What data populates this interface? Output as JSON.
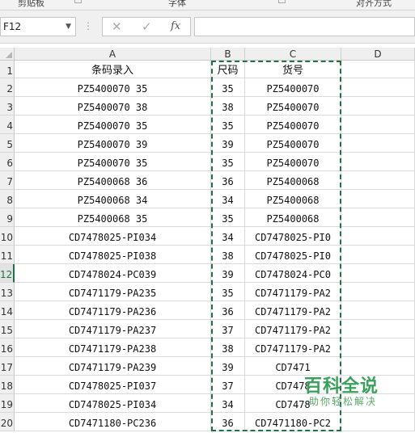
{
  "ribbon": {
    "groups": [
      "剪贴板",
      "字体",
      "对齐方式"
    ]
  },
  "formula_bar": {
    "name_box": "F12",
    "fx_label": "fx",
    "formula": ""
  },
  "columns": [
    "A",
    "B",
    "C",
    "D"
  ],
  "rows": [
    {
      "num": "1",
      "a": "条码录入",
      "b": "尺码",
      "c": "货号"
    },
    {
      "num": "2",
      "a": "PZ5400070 35",
      "b": "35",
      "c": "PZ5400070"
    },
    {
      "num": "3",
      "a": "PZ5400070 38",
      "b": "38",
      "c": "PZ5400070"
    },
    {
      "num": "4",
      "a": "PZ5400070 35",
      "b": "35",
      "c": "PZ5400070"
    },
    {
      "num": "5",
      "a": "PZ5400070 39",
      "b": "39",
      "c": "PZ5400070"
    },
    {
      "num": "6",
      "a": "PZ5400070 35",
      "b": "35",
      "c": "PZ5400070"
    },
    {
      "num": "7",
      "a": "PZ5400068 36",
      "b": "36",
      "c": "PZ5400068"
    },
    {
      "num": "8",
      "a": "PZ5400068 34",
      "b": "34",
      "c": "PZ5400068"
    },
    {
      "num": "9",
      "a": "PZ5400068 35",
      "b": "35",
      "c": "PZ5400068"
    },
    {
      "num": "10",
      "a": "CD7478025-PI034",
      "b": "34",
      "c": "CD7478025-PI0"
    },
    {
      "num": "11",
      "a": "CD7478025-PI038",
      "b": "38",
      "c": "CD7478025-PI0"
    },
    {
      "num": "12",
      "a": "CD7478024-PC039",
      "b": "39",
      "c": "CD7478024-PC0"
    },
    {
      "num": "13",
      "a": "CD7471179-PA235",
      "b": "35",
      "c": "CD7471179-PA2"
    },
    {
      "num": "14",
      "a": "CD7471179-PA236",
      "b": "36",
      "c": "CD7471179-PA2"
    },
    {
      "num": "15",
      "a": "CD7471179-PA237",
      "b": "37",
      "c": "CD7471179-PA2"
    },
    {
      "num": "16",
      "a": "CD7471179-PA238",
      "b": "38",
      "c": "CD7471179-PA2"
    },
    {
      "num": "17",
      "a": "CD7471179-PA239",
      "b": "39",
      "c": "CD7471"
    },
    {
      "num": "18",
      "a": "CD7478025-PI037",
      "b": "37",
      "c": "CD7478"
    },
    {
      "num": "19",
      "a": "CD7478025-PI034",
      "b": "34",
      "c": "CD7478"
    },
    {
      "num": "20",
      "a": "CD7471180-PC236",
      "b": "36",
      "c": "CD7471180-PC2"
    }
  ],
  "watermark": {
    "title": "百科全说",
    "subtitle": "助你轻松解决"
  },
  "colors": {
    "accent": "#217346",
    "watermark": "#3aa15a"
  }
}
